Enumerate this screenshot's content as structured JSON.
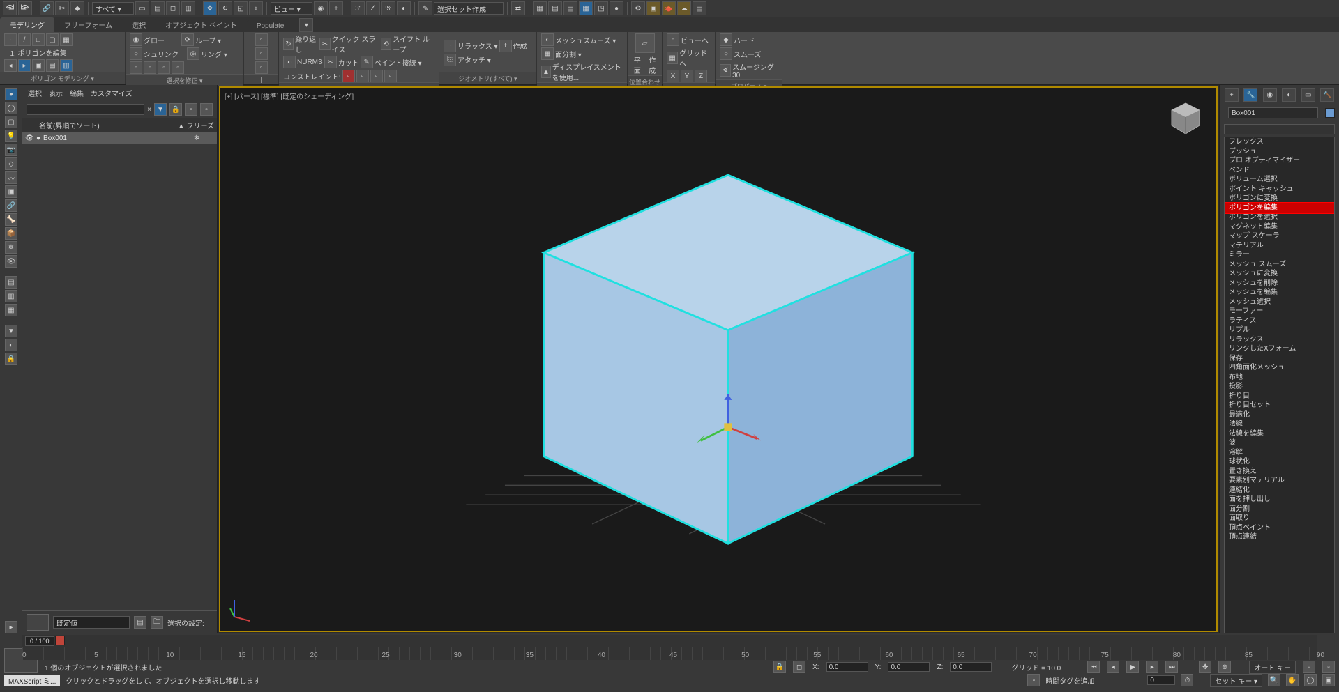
{
  "top": {
    "filter_all": "すべて ▾",
    "view_label": "ビュー ▾",
    "selset_label": "選択セット作成"
  },
  "ribbon": {
    "tabs": [
      "モデリング",
      "フリーフォーム",
      "選択",
      "オブジェクト ペイント",
      "Populate"
    ],
    "panel1_title": "ポリゴン モデリング ▾",
    "panel1_sub": "1: ポリゴンを編集",
    "panel2_title": "選択を修正 ▾",
    "panel2_items": [
      "グロー",
      "シュリンク",
      "ループ ▾",
      "リング ▾"
    ],
    "panel3_title": "編集",
    "panel3_items": [
      "繰り返し",
      "NURMS",
      "コンストレイント:"
    ],
    "panel4_items": [
      "クイック スライス",
      "カット",
      "ペイント接続 ▾",
      "スイフト ループ"
    ],
    "panel5_title": "ジオメトリ(すべて) ▾",
    "panel5_items": [
      "リラックス ▾",
      "アタッチ ▾",
      "作成"
    ],
    "panel6_title": "サブディビジョン",
    "panel6_items": [
      "メッシュスムーズ ▾",
      "面分割 ▾",
      "ディスプレイスメントを使用..."
    ],
    "panel7_title": "位置合わせ",
    "panel7_items": [
      "平面",
      "作成",
      "X",
      "Y",
      "Z"
    ],
    "panel8_title": "プロパティ ▾",
    "panel8_items": [
      "ビューへ",
      "グリッドへ",
      "ハード",
      "スムーズ",
      "スムージング 30"
    ]
  },
  "left": {
    "menus": [
      "選択",
      "表示",
      "編集",
      "カスタマイズ"
    ],
    "col_name": "名前(昇順でソート)",
    "col_freeze": "▲ フリーズ",
    "obj": "Box001",
    "bottom_label": "既定値",
    "sel_setting": "選択の設定:"
  },
  "viewport": {
    "label": "[+] [パース] [標準] [既定のシェーディング]"
  },
  "right": {
    "obj_name": "Box001",
    "modifiers": [
      "フレックス",
      "プッシュ",
      "プロ オプティマイザー",
      "ベンド",
      "ボリューム選択",
      "ポイント キャッシュ",
      "ポリゴンに変換",
      "ポリゴンを編集",
      "ポリゴンを選択",
      "マグネット編集",
      "マップ スケーラ",
      "マテリアル",
      "ミラー",
      "メッシュ スムーズ",
      "メッシュに変換",
      "メッシュを削除",
      "メッシュを編集",
      "メッシュ選択",
      "モーファー",
      "ラティス",
      "リプル",
      "リラックス",
      "リンクしたXフォーム",
      "保存",
      "四角面化メッシュ",
      "布地",
      "投影",
      "折り目",
      "折り目セット",
      "最適化",
      "法線",
      "法線を編集",
      "波",
      "溶解",
      "球状化",
      "置き換え",
      "要素別マテリアル",
      "連結化",
      "面を押し出し",
      "面分割",
      "面取り",
      "頂点ペイント",
      "頂点連結"
    ],
    "highlight_index": 7
  },
  "footer": {
    "frame_display": "0 / 100",
    "ruler_ticks": [
      0,
      5,
      10,
      15,
      20,
      25,
      30,
      35,
      40,
      45,
      50,
      55,
      60,
      65,
      70,
      75,
      80,
      85,
      90
    ],
    "status1": "1 個のオブジェクトが選択されました",
    "status2": "クリックとドラッグをして、オブジェクトを選択し移動します",
    "x_label": "X:",
    "x_val": "0.0",
    "y_label": "Y:",
    "y_val": "0.0",
    "z_label": "Z:",
    "z_val": "0.0",
    "grid_label": "グリッド = 10.0",
    "autokey": "オート キー",
    "setkey": "セット キー ▾",
    "timetag": "時間タグを追加",
    "maxscript": "MAXScript ミ..."
  }
}
